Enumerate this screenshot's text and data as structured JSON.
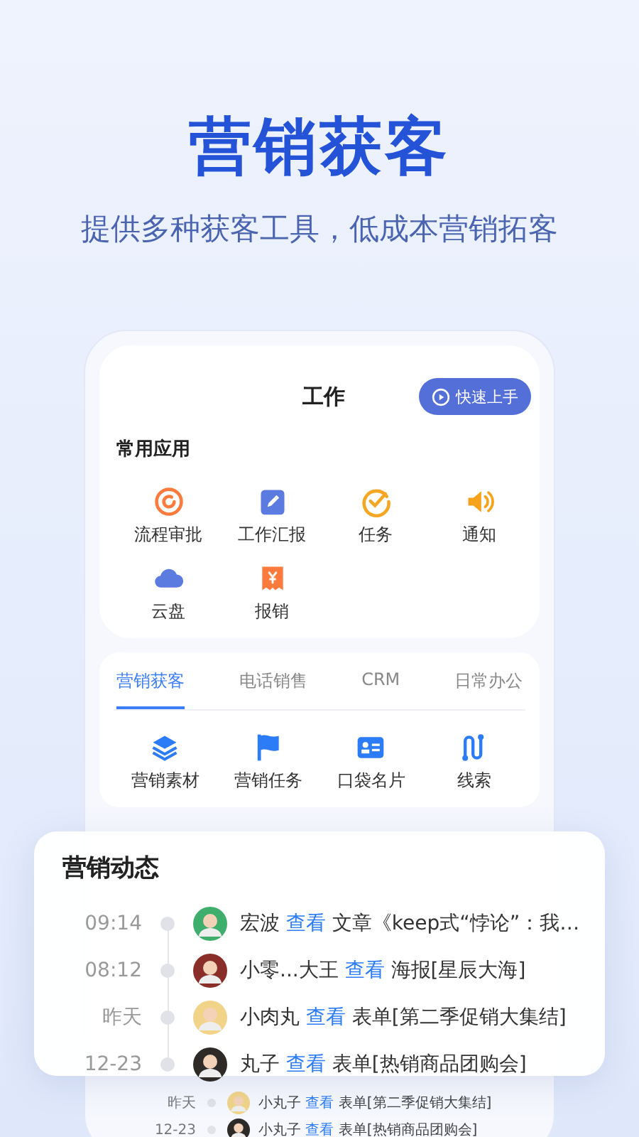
{
  "headline": "营销获客",
  "subtitle": "提供多种获客工具，低成本营销拓客",
  "work": {
    "title": "工作",
    "quick_button": "快速上手",
    "section": "常用应用",
    "apps": [
      {
        "kind": "approval",
        "label": "流程审批"
      },
      {
        "kind": "report",
        "label": "工作汇报"
      },
      {
        "kind": "task",
        "label": "任务"
      },
      {
        "kind": "notice",
        "label": "通知"
      },
      {
        "kind": "cloud",
        "label": "云盘"
      },
      {
        "kind": "expense",
        "label": "报销"
      }
    ]
  },
  "tabs": [
    {
      "label": "营销获客",
      "selected": true
    },
    {
      "label": "电话销售",
      "selected": false
    },
    {
      "label": "CRM",
      "selected": false
    },
    {
      "label": "日常办公",
      "selected": false
    }
  ],
  "tools": [
    {
      "kind": "layers",
      "label": "营销素材"
    },
    {
      "kind": "flag",
      "label": "营销任务"
    },
    {
      "kind": "card",
      "label": "口袋名片"
    },
    {
      "kind": "path",
      "label": "线索"
    }
  ],
  "background_feed": [
    {
      "time": "昨天",
      "color": "#f1d48a",
      "name": "小丸子",
      "action": "查看",
      "object": "表单[第二季促销大集结]"
    },
    {
      "time": "12-23",
      "color": "#2e2a28",
      "name": "小丸子",
      "action": "查看",
      "object": "表单[热销商品团购会]"
    }
  ],
  "feed": {
    "title": "营销动态",
    "items": [
      {
        "time": "09:14",
        "color": "#3fae6c",
        "name": "宏波",
        "action": "查看",
        "object": "文章《keep式“悖论”：我…"
      },
      {
        "time": "08:12",
        "color": "#8a2e2a",
        "name": "小零...大王",
        "action": "查看",
        "object": "海报[星辰大海]"
      },
      {
        "time": "昨天",
        "color": "#f1d48a",
        "name": "小肉丸",
        "action": "查看",
        "object": "表单[第二季促销大集结]"
      },
      {
        "time": "12-23",
        "color": "#2e2a28",
        "name": "丸子",
        "action": "查看",
        "object": "表单[热销商品团购会]"
      }
    ]
  }
}
